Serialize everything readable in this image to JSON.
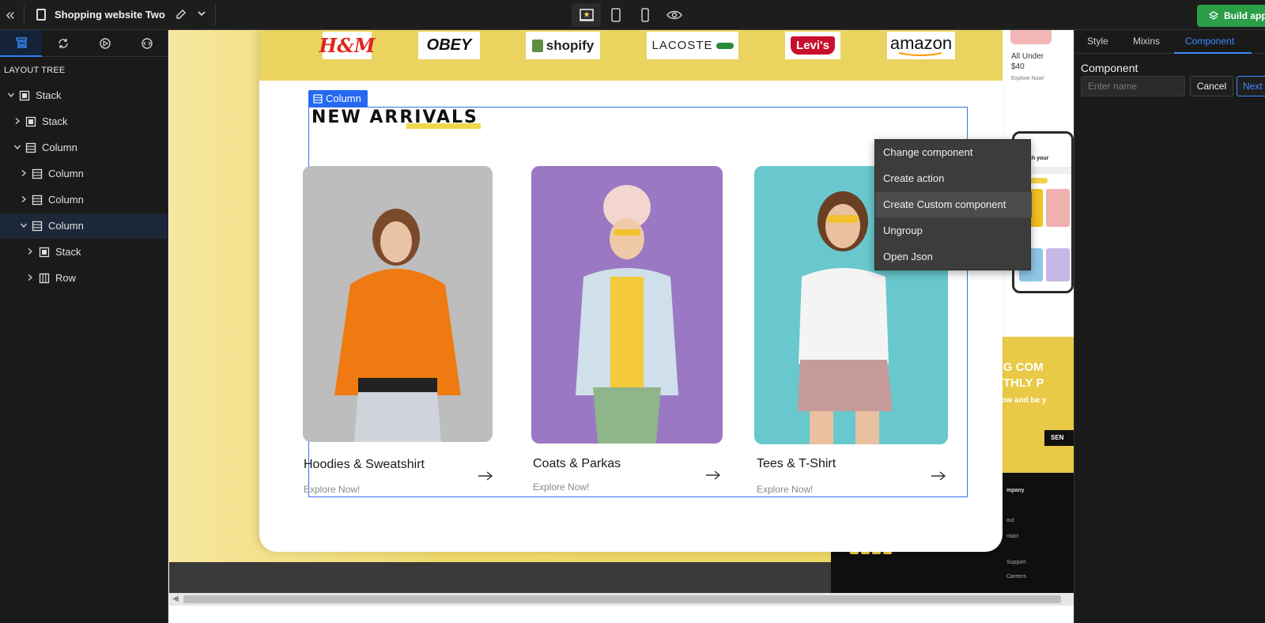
{
  "topbar": {
    "doc_title": "Shopping website Two",
    "build_label": "Build app",
    "colors": {
      "build": "#2c9e47",
      "accent": "#2f7cf6"
    }
  },
  "left_panel": {
    "heading": "LAYOUT TREE",
    "tabs": [
      "layers-icon",
      "sync-icon",
      "navigator-icon",
      "code-icon"
    ],
    "tree": [
      {
        "label": "Stack",
        "expanded": true,
        "icon": "stack-icon"
      },
      {
        "label": "Stack",
        "expanded": false,
        "icon": "stack-icon"
      },
      {
        "label": "Column",
        "expanded": true,
        "icon": "column-icon"
      },
      {
        "label": "Column",
        "expanded": false,
        "icon": "column-icon"
      },
      {
        "label": "Column",
        "expanded": false,
        "icon": "column-icon"
      },
      {
        "label": "Column",
        "expanded": true,
        "icon": "column-icon",
        "selected": true
      },
      {
        "label": "Stack",
        "expanded": false,
        "icon": "stack-icon"
      },
      {
        "label": "Row",
        "expanded": false,
        "icon": "row-icon"
      }
    ]
  },
  "canvas": {
    "brands": [
      "H&M",
      "OBEY",
      "shopify",
      "LACOSTE",
      "Levi's",
      "amazon"
    ],
    "selection_badge": "Column",
    "section_title": "NEW ARRIVALS",
    "products": [
      {
        "name": "Hoodies & Sweatshirt",
        "cta": "Explore Now!",
        "bg": "#b8b8b8"
      },
      {
        "name": "Coats & Parkas",
        "cta": "Explore Now!",
        "bg": "#9d79c4"
      },
      {
        "name": "Tees & T-Shirt",
        "cta": "Explore Now!",
        "bg": "#65c7cc"
      }
    ],
    "context_menu": [
      "Change component",
      "Create action",
      "Create Custom component",
      "Ungroup",
      "Open Json"
    ],
    "context_menu_hover": 2,
    "side_preview": {
      "price_line1": "All Under",
      "price_line2": "$40",
      "explore": "Explore Now!",
      "phone_title": "Match your",
      "banner1": "NG COM",
      "banner2": "NTHLY P",
      "banner3": "elow and be y",
      "send": "SEN",
      "footer_items": [
        "mpany",
        "out",
        "ntact",
        "Support",
        "Careers"
      ]
    }
  },
  "right_panel": {
    "tabs": [
      "Style",
      "Mixins",
      "Component"
    ],
    "active_tab": "Component",
    "label": "Component",
    "input_placeholder": "Enter name",
    "cancel": "Cancel",
    "next": "Next"
  }
}
